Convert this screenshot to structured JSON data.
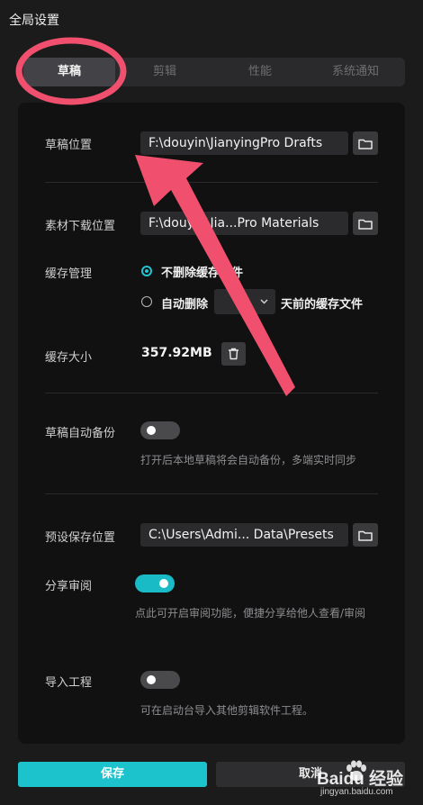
{
  "window": {
    "title": "全局设置"
  },
  "tabs": [
    {
      "label": "草稿",
      "active": true
    },
    {
      "label": "剪辑",
      "active": false
    },
    {
      "label": "性能",
      "active": false
    },
    {
      "label": "系统通知",
      "active": false
    }
  ],
  "draft_location": {
    "label": "草稿位置",
    "path": "F:\\douyin\\JianyingPro Drafts"
  },
  "material_location": {
    "label": "素材下载位置",
    "path": "F:\\douyin\\Jia...Pro Materials"
  },
  "cache": {
    "label": "缓存管理",
    "option_keep": "不删除缓存文件",
    "option_auto": "自动删除",
    "days_value": "",
    "days_suffix": "天前的缓存文件",
    "selected": "keep"
  },
  "cache_size": {
    "label": "缓存大小",
    "value": "357.92MB"
  },
  "auto_backup": {
    "label": "草稿自动备份",
    "enabled": false,
    "hint": "打开后本地草稿将会自动备份，多端实时同步"
  },
  "preset_location": {
    "label": "预设保存位置",
    "path": "C:\\Users\\Admi... Data\\Presets"
  },
  "share_review": {
    "label": "分享审阅",
    "enabled": true,
    "hint": "点此可开启审阅功能，便捷分享给他人查看/审阅"
  },
  "import_project": {
    "label": "导入工程",
    "enabled": false,
    "hint": "可在启动台导入其他剪辑软件工程。"
  },
  "buttons": {
    "save": "保存",
    "cancel": "取消"
  },
  "watermark": {
    "logo": "Baidu 经验",
    "url": "jingyan.baidu.com"
  },
  "colors": {
    "accent": "#1cc3cc",
    "annotation": "#f0506e",
    "background": "#1b1b1c",
    "panel": "#111112"
  }
}
